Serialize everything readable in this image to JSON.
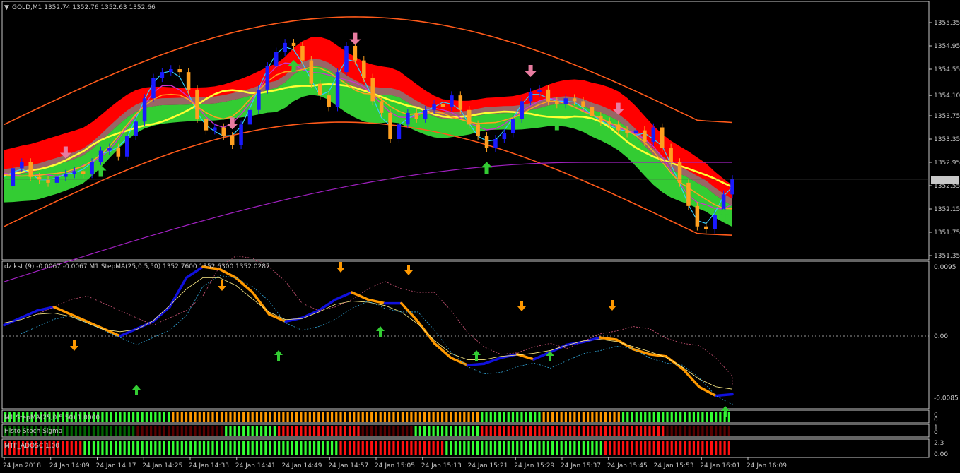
{
  "window": {
    "symbol_header": "GOLD,M1  1352.74 1352.76 1352.63 1352.66",
    "current_price_label": "1352.66"
  },
  "colors": {
    "background": "#000000",
    "frame": "#c8c8c8",
    "bull_candle": "#1a1aff",
    "bear_candle": "#ffa020",
    "cloud_red": "#ff0000",
    "cloud_green": "#33cc33",
    "cloud_gray": "#808080",
    "upper_band": "#ff5a1a",
    "lower_band": "#ff5a1a",
    "ma_yellow": "#ffff33",
    "ma_magenta": "#cc33cc",
    "ma_slow_purple": "#a020c0",
    "fast_cyan": "#33ccff",
    "signal_down": "#e87ca0",
    "signal_up": "#33cc33",
    "kst_blue": "#1010dd",
    "kst_orange": "#ff9900",
    "bar_green": "#33ff33",
    "bar_orange": "#ff9900",
    "bar_darkred": "#5a0000",
    "bar_darkgreen": "#006600",
    "bar_red": "#ff1010"
  },
  "price_axis": {
    "min": 1351.35,
    "max": 1355.35,
    "ticks": [
      "1355.35",
      "1354.95",
      "1354.55",
      "1354.10",
      "1353.75",
      "1353.35",
      "1352.95",
      "1352.55",
      "1352.15",
      "1351.75",
      "1351.35"
    ]
  },
  "time_axis": {
    "ticks": [
      "24 Jan 2018",
      "24 Jan 14:09",
      "24 Jan 14:17",
      "24 Jan 14:25",
      "24 Jan 14:33",
      "24 Jan 14:41",
      "24 Jan 14:49",
      "24 Jan 14:57",
      "24 Jan 15:05",
      "24 Jan 15:13",
      "24 Jan 15:21",
      "24 Jan 15:29",
      "24 Jan 15:37",
      "24 Jan 15:45",
      "24 Jan 15:53",
      "24 Jan 16:01",
      "24 Jan 16:09"
    ]
  },
  "subpanel": {
    "header": "dz kst (9) -0.0067 -0.0067  M1 StepMA(25,0.5,50) 1352.7600 1352.6300 1352.0287",
    "ticks": [
      "0.0095",
      "0.00",
      "-0.0085"
    ],
    "min": -0.0095,
    "max": 0.0095
  },
  "bar_panels": [
    {
      "label": "M1 StepMA(25,0.5,50) 1.0000",
      "right_ticks": [
        "0",
        "0"
      ]
    },
    {
      "label": "Histo Stoch Sigma",
      "right_ticks": [
        "1",
        "0"
      ]
    },
    {
      "label": "MTF_ADOSC 1.00",
      "right_ticks": [
        "2.3",
        "0.00"
      ]
    }
  ],
  "chart_data": {
    "type": "candlestick",
    "title": "GOLD,M1",
    "ylim": [
      1351.35,
      1355.35
    ],
    "close_path": [
      1352.55,
      1352.85,
      1352.95,
      1352.7,
      1352.65,
      1352.6,
      1352.7,
      1352.75,
      1352.8,
      1352.75,
      1352.95,
      1353.15,
      1353.2,
      1353.05,
      1353.4,
      1353.65,
      1354.05,
      1354.4,
      1354.5,
      1354.55,
      1354.5,
      1354.2,
      1353.7,
      1353.5,
      1353.55,
      1353.4,
      1353.25,
      1353.6,
      1353.85,
      1354.2,
      1354.6,
      1354.85,
      1355.0,
      1354.95,
      1354.7,
      1354.3,
      1354.1,
      1353.9,
      1354.5,
      1354.95,
      1354.7,
      1354.4,
      1354.0,
      1353.8,
      1353.35,
      1353.6,
      1353.8,
      1353.7,
      1353.85,
      1353.95,
      1353.9,
      1354.1,
      1353.85,
      1353.6,
      1353.4,
      1353.2,
      1353.35,
      1353.45,
      1353.7,
      1354.0,
      1354.15,
      1354.2,
      1354.0,
      1353.95,
      1354.05,
      1354.0,
      1353.9,
      1353.75,
      1353.65,
      1353.6,
      1353.5,
      1353.45,
      1353.5,
      1353.3,
      1353.55,
      1353.2,
      1352.95,
      1352.6,
      1352.2,
      1351.85,
      1351.8,
      1352.05,
      1352.4,
      1352.66
    ],
    "kst_series": [
      0.0015,
      0.0025,
      0.0035,
      0.004,
      0.003,
      0.002,
      0.001,
      0.0,
      0.001,
      0.002,
      0.004,
      0.008,
      0.0095,
      0.0092,
      0.008,
      0.006,
      0.003,
      0.002,
      0.0025,
      0.0035,
      0.005,
      0.006,
      0.005,
      0.0045,
      0.0045,
      0.002,
      -0.001,
      -0.003,
      -0.004,
      -0.0038,
      -0.003,
      -0.0025,
      -0.0032,
      -0.0022,
      -0.0012,
      -0.0008,
      -0.0002,
      -0.0005,
      -0.0018,
      -0.0025,
      -0.0028,
      -0.0045,
      -0.007,
      -0.0082,
      -0.008
    ],
    "up_arrows_price": [
      13,
      40,
      66,
      76,
      99
    ],
    "down_arrows_price": [
      8,
      31,
      48,
      72,
      84
    ]
  }
}
